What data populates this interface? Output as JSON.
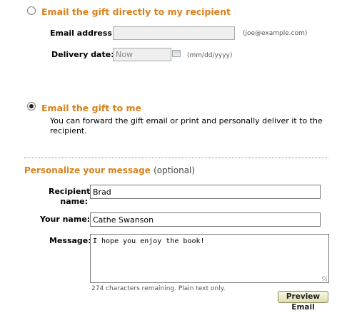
{
  "option_direct": {
    "heading": "Email the gift directly to my recipient",
    "email_label": "Email address:",
    "email_hint": "(joe@example.com)",
    "delivery_label": "Delivery date:",
    "delivery_value": "Now",
    "delivery_hint": "(mm/dd/yyyy)",
    "selected": false
  },
  "option_me": {
    "heading": "Email the gift to me",
    "description": "You can forward the gift email or print and personally deliver it to the recipient.",
    "selected": true
  },
  "personalize": {
    "title": "Personalize your message",
    "optional": "(optional)",
    "recipient_label_line1": "Recipient",
    "recipient_label_line2": "name:",
    "recipient_value": "Brad",
    "your_name_label": "Your name:",
    "your_name_value": "Cathe Swanson",
    "message_label": "Message:",
    "message_value": "I hope you enjoy the book!",
    "chars_remaining": "274 characters remaining. Plain text only.",
    "preview_button": "Preview Email"
  },
  "colors": {
    "accent": "#d9801c"
  }
}
